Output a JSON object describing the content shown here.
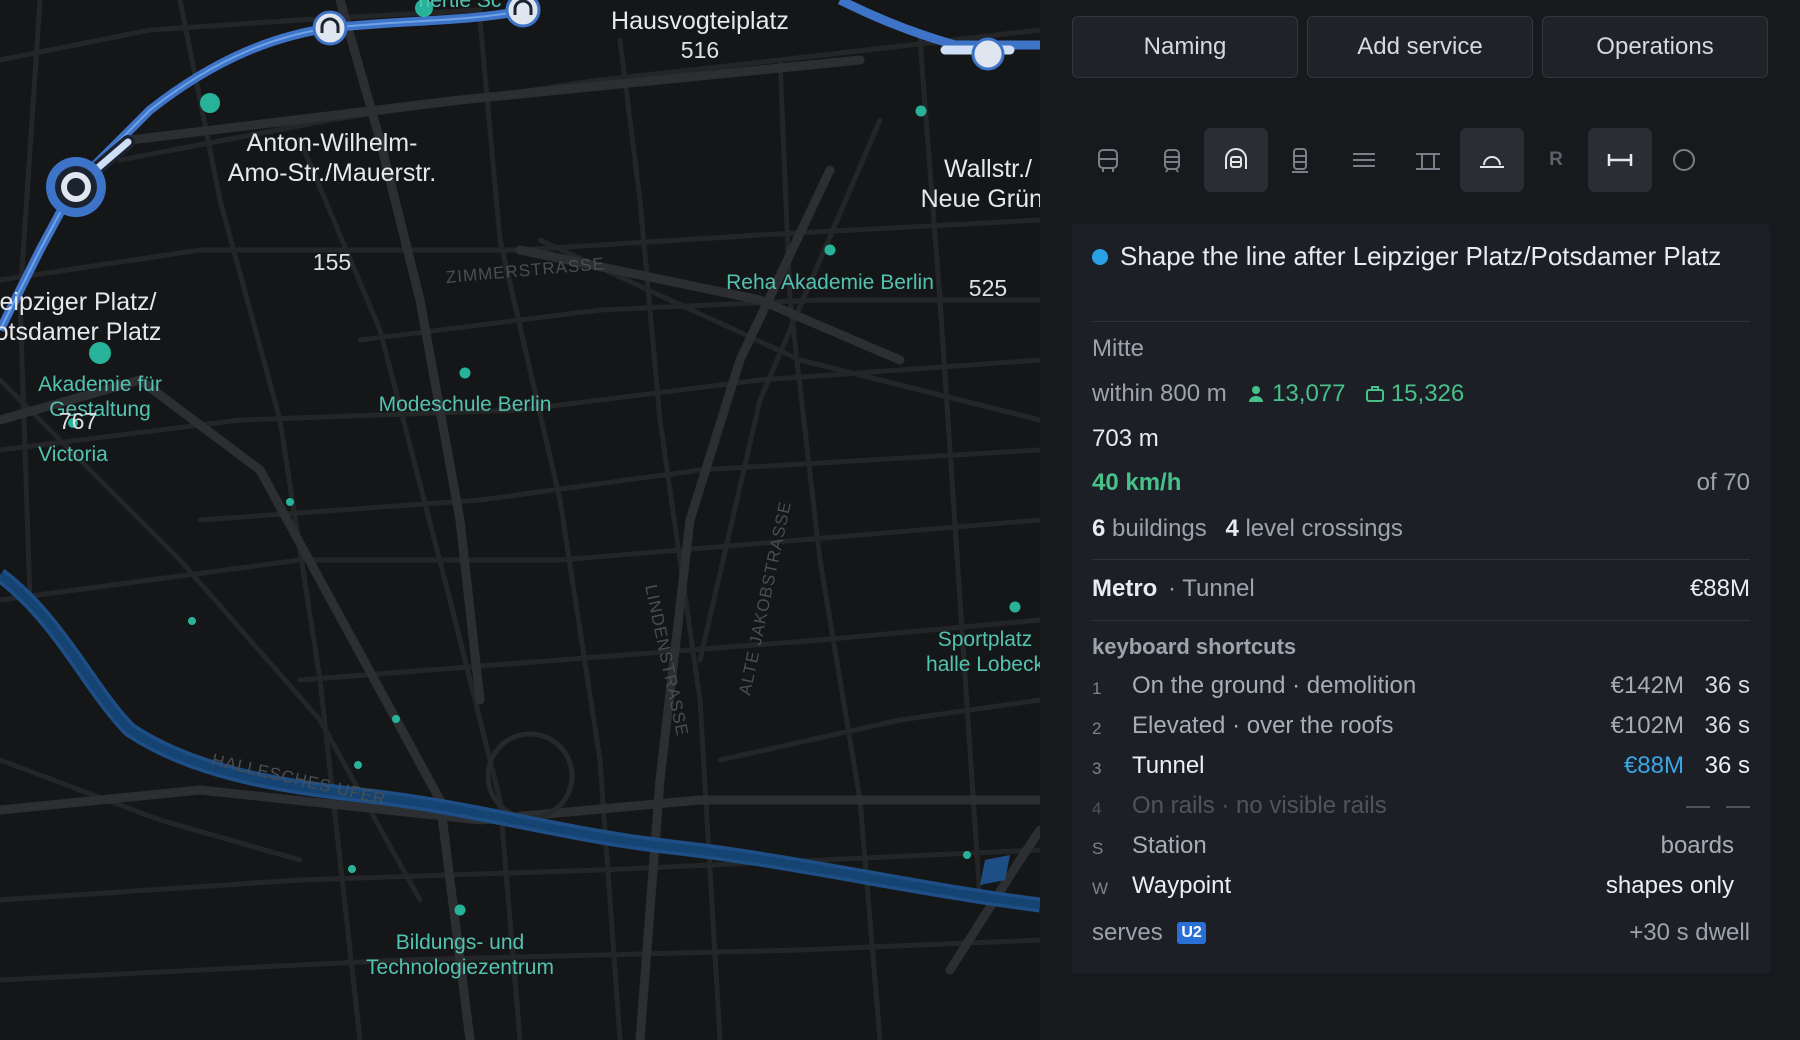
{
  "map": {
    "stations": [
      {
        "name": "Hausvogteiplatz",
        "rid": "516"
      },
      {
        "name": "Anton-Wilhelm-\nAmo-Str./Mauerstr.",
        "rid": "155"
      },
      {
        "name": "Wallstr./\nNeue Grüns",
        "rid": "525"
      },
      {
        "name": "eipziger Platz/\notsdamer Platz",
        "rid": "767"
      }
    ],
    "partial_label": "nertie Sc",
    "pois": [
      "Reha Akademie Berlin",
      "Akademie für\nGestaltung",
      "Victoria",
      "Modeschule Berlin",
      "Sportplatz\nhalle Lobeck",
      "Bildungs- und\nTechnologiezentrum"
    ],
    "streets": [
      "ZIMMERSTRASSE",
      "LINDENSTRASSE",
      "ALTE JAKOBSTRASSE",
      "HALLESCHES UFER"
    ]
  },
  "panel": {
    "buttons": [
      "Naming",
      "Add service",
      "Operations"
    ],
    "tools": {
      "vehicles": [
        "bus-icon",
        "tram-icon",
        "metro-icon",
        "train-icon"
      ],
      "placement": [
        "ground-icon",
        "elevated-icon",
        "tunnel-icon"
      ],
      "placement_r": "R",
      "shape": [
        "straight-icon",
        "loop-icon"
      ]
    },
    "card": {
      "title": "Shape the line after Leipziger Platz/Potsdamer Platz",
      "district": "Mitte",
      "within": "within 800 m",
      "people": "13,077",
      "jobs": "15,326",
      "length": "703 m",
      "speed": "40 km/h",
      "speed_of": "of 70",
      "buildings_n": "6",
      "buildings_label": "buildings",
      "crossings_n": "4",
      "crossings_label": "level crossings",
      "mode": "Metro",
      "placement": "· Tunnel",
      "cost": "€88M",
      "shortcuts_title": "keyboard shortcuts",
      "shortcuts": [
        {
          "key": "1",
          "label": "On the ground · demolition",
          "cost": "€142M",
          "time": "36 s"
        },
        {
          "key": "2",
          "label": "Elevated · over the roofs",
          "cost": "€102M",
          "time": "36 s"
        },
        {
          "key": "3",
          "label": "Tunnel",
          "cost": "€88M",
          "time": "36 s"
        },
        {
          "key": "4",
          "label": "On rails · no visible rails"
        },
        {
          "key": "S",
          "label": "Station",
          "extra": "boards"
        },
        {
          "key": "W",
          "label": "Waypoint",
          "extra": "shapes only"
        }
      ],
      "serves_label": "serves",
      "serves_line": "U2",
      "dwell": "+30 s dwell"
    }
  },
  "colors": {
    "line": "#4a7fd0",
    "accent_green": "#48c08a",
    "accent_blue": "#2aa0e6",
    "poi": "#27b39a"
  }
}
